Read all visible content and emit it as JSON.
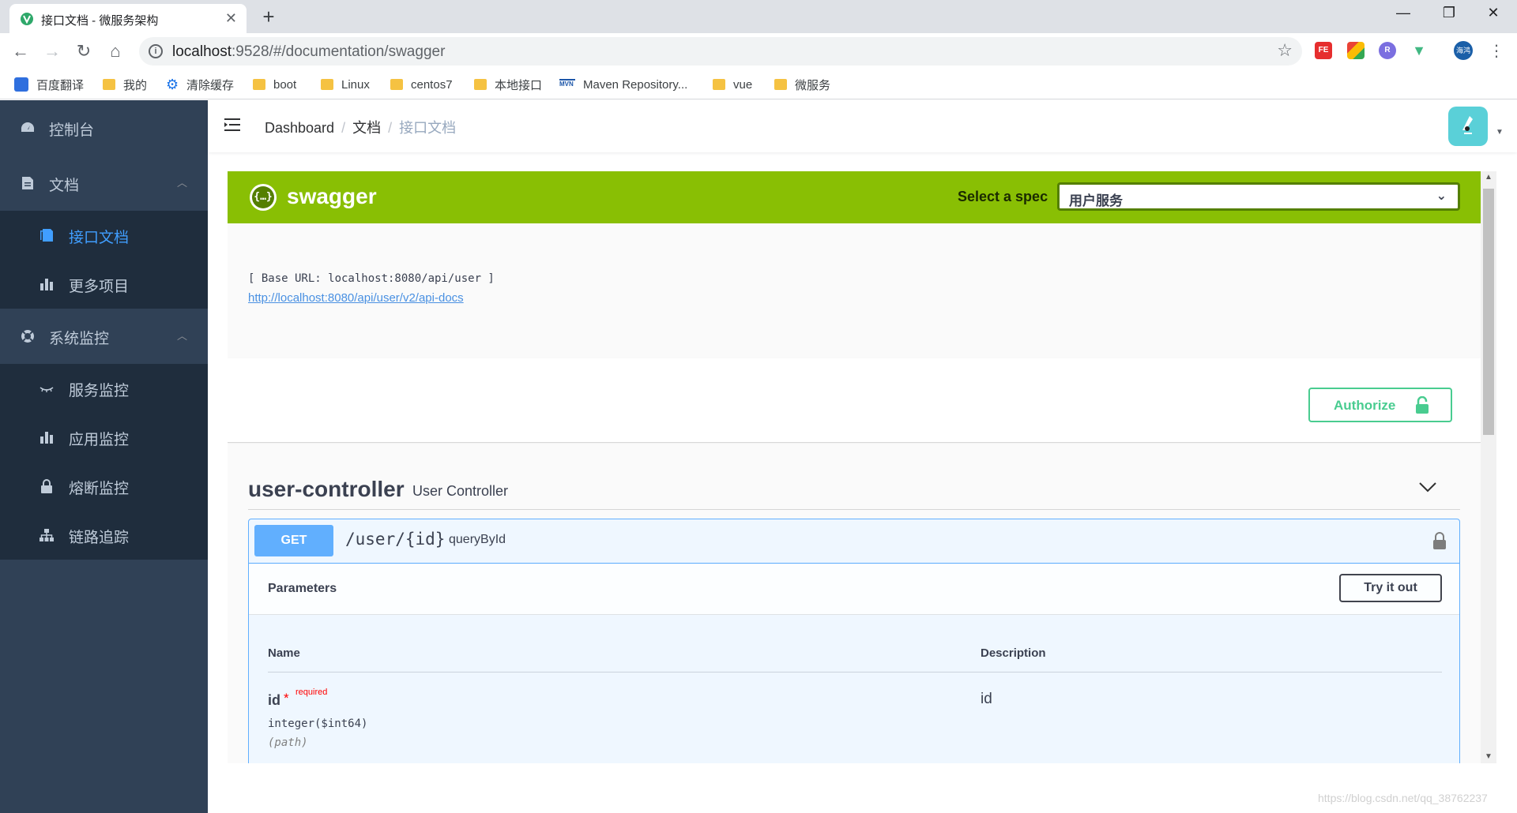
{
  "browser": {
    "tab_title": "接口文档 - 微服务架构",
    "tab_close": "✕",
    "new_tab": "+",
    "window_controls": {
      "minimize": "—",
      "restore": "❐",
      "close": "✕"
    },
    "url_host": "localhost",
    "url_rest": ":9528/#/documentation/swagger",
    "info": "i",
    "extensions": [
      {
        "name": "fe-extension-icon",
        "text": "FE",
        "color": "#e62e2e"
      },
      {
        "name": "colorful-extension-icon",
        "text": "",
        "color": "#34a853"
      },
      {
        "name": "r-extension-icon",
        "text": "R",
        "color": "#7b6fe0"
      },
      {
        "name": "vue-devtools-icon",
        "text": "V",
        "color": "#42b883"
      }
    ],
    "profile_label": "海鸿",
    "bookmarks": [
      {
        "label": "百度翻译",
        "icon": "translate-icon"
      },
      {
        "label": "我的",
        "icon": "folder-icon"
      },
      {
        "label": "清除缓存",
        "icon": "gear-icon"
      },
      {
        "label": "boot",
        "icon": "folder-icon"
      },
      {
        "label": "Linux",
        "icon": "folder-icon"
      },
      {
        "label": "centos7",
        "icon": "folder-icon"
      },
      {
        "label": "本地接口",
        "icon": "folder-icon"
      },
      {
        "label": "Maven Repository...",
        "icon": "mvn-icon"
      },
      {
        "label": "vue",
        "icon": "folder-icon"
      },
      {
        "label": "微服务",
        "icon": "folder-icon"
      }
    ]
  },
  "sidebar": {
    "console": "控制台",
    "docs": "文档",
    "docs_items": [
      "接口文档",
      "更多项目"
    ],
    "monitor": "系统监控",
    "monitor_items": [
      "服务监控",
      "应用监控",
      "熔断监控",
      "链路追踪"
    ],
    "colors": {
      "bg": "#304156",
      "sub_bg": "#1f2d3d",
      "active": "#409eff"
    }
  },
  "navbar": {
    "breadcrumb": [
      "Dashboard",
      "文档",
      "接口文档"
    ],
    "separator": "/"
  },
  "swagger": {
    "brand": "swagger",
    "logo_glyph": "{…}",
    "select_label": "Select a spec",
    "selected_spec": "用户服务",
    "base_url": "[ Base URL: localhost:8080/api/user ]",
    "api_docs_link": "http://localhost:8080/api/user/v2/api-docs",
    "authorize": "Authorize",
    "tag_name": "user-controller",
    "tag_desc": "User Controller",
    "operation": {
      "method": "GET",
      "path": "/user/{id}",
      "summary": "queryById"
    },
    "parameters_title": "Parameters",
    "try_it_out": "Try it out",
    "columns": {
      "name": "Name",
      "description": "Description"
    },
    "param": {
      "name": "id",
      "required_mark": "*",
      "required_label": "required",
      "type": "integer($int64)",
      "in": "(path)",
      "description": "id"
    },
    "colors": {
      "topbar": "#89bf04",
      "get": "#61affe",
      "authorize": "#49cc90"
    }
  },
  "watermark": "https://blog.csdn.net/qq_38762237"
}
